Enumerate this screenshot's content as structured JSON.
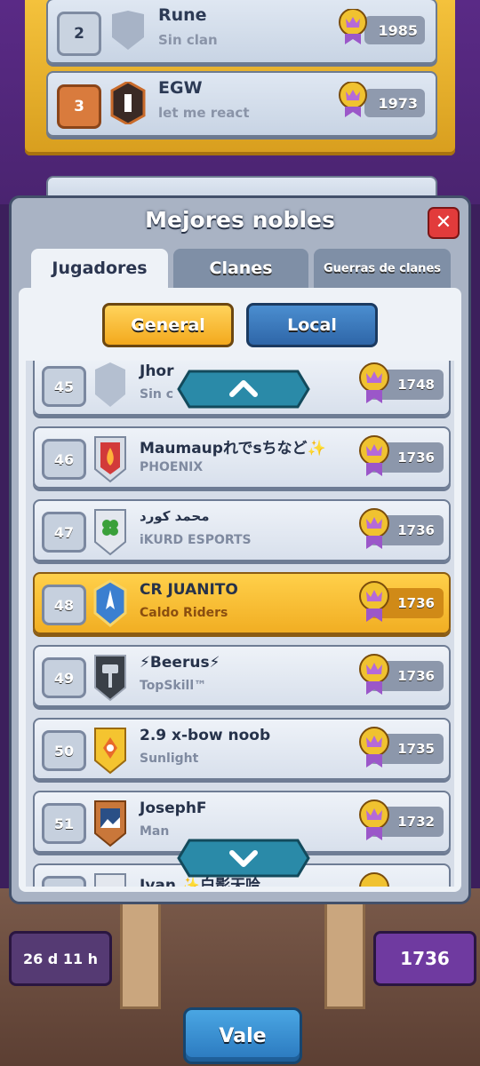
{
  "background": {
    "top_rows": [
      {
        "rank": "2",
        "name": "Rune",
        "clan": "Sin clan",
        "trophies": "1985"
      },
      {
        "rank": "3",
        "name": "EGW",
        "clan": "let me react",
        "trophies": "1973"
      }
    ],
    "timer": "26 d 11 h",
    "my_trophies": "1736"
  },
  "modal": {
    "title": "Mejores nobles",
    "tabs": [
      {
        "label": "Jugadores"
      },
      {
        "label": "Clanes"
      },
      {
        "label": "Guerras de clanes"
      }
    ],
    "segments": {
      "general": "General",
      "local": "Local"
    },
    "players": [
      {
        "rank": "45",
        "name": "Jhor",
        "clan": "Sin c",
        "trophies": "1748"
      },
      {
        "rank": "46",
        "name": "Maumaupれでsちなど✨",
        "clan": "PHOENIX",
        "trophies": "1736"
      },
      {
        "rank": "47",
        "name": "محمد كورد",
        "clan": "iKURD ESPORTS",
        "trophies": "1736"
      },
      {
        "rank": "48",
        "name": "CR JUANITO",
        "clan": "Caldo Riders",
        "trophies": "1736"
      },
      {
        "rank": "49",
        "name": "⚡Beerus⚡",
        "clan": "TopSkill™",
        "trophies": "1736"
      },
      {
        "rank": "50",
        "name": "2.9 x-bow noob",
        "clan": "Sunlight",
        "trophies": "1735"
      },
      {
        "rank": "51",
        "name": "JosephF",
        "clan": "Man",
        "trophies": "1732"
      },
      {
        "rank": "",
        "name": "Ivan ✨白影天哈",
        "clan": "",
        "trophies": ""
      }
    ]
  },
  "footer": {
    "ok_label": "Vale"
  },
  "colors": {
    "gold": "#f3a91d",
    "blue": "#2e66a8",
    "close_red": "#e23b3b",
    "purple": "#4a2470"
  }
}
